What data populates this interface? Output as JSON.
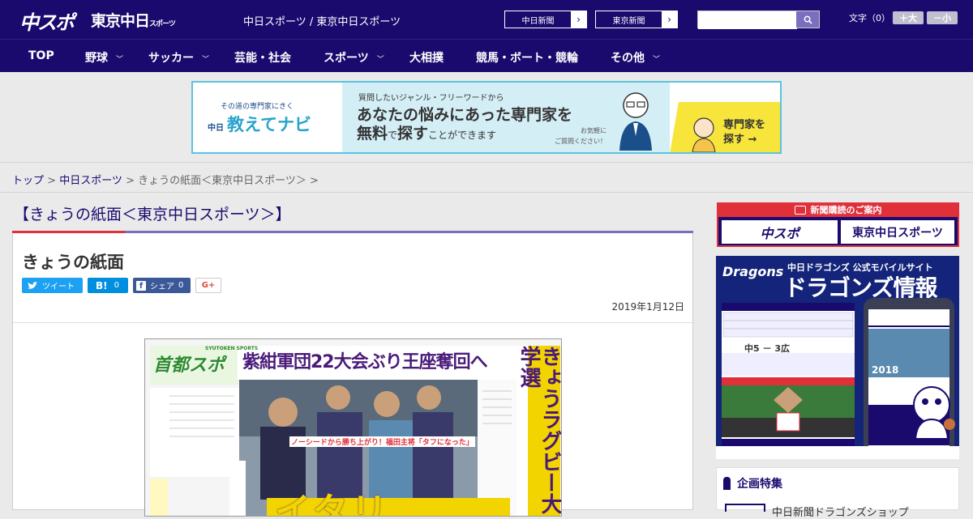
{
  "header": {
    "logo_1": "中スポ",
    "logo_2": "東京中日",
    "logo_2_small": "スポーツ",
    "tagline": "中日スポーツ / 東京中日スポーツ",
    "paper_links": [
      {
        "label": "中日新聞",
        "arrow": "›"
      },
      {
        "label": "東京新聞",
        "arrow": "›"
      }
    ],
    "search_placeholder": "",
    "font_size_label": "文字（0）",
    "font_larger": "＋大",
    "font_smaller": "－小"
  },
  "nav": {
    "items": [
      {
        "label": "TOP",
        "chevron": ""
      },
      {
        "label": "野球",
        "chevron": "﹀"
      },
      {
        "label": "サッカー",
        "chevron": "﹀"
      },
      {
        "label": "芸能・社会",
        "chevron": ""
      },
      {
        "label": "スポーツ",
        "chevron": "﹀"
      },
      {
        "label": "大相撲",
        "chevron": ""
      },
      {
        "label": "競馬・ボート・競輪",
        "chevron": ""
      },
      {
        "label": "その他",
        "chevron": "﹀"
      }
    ]
  },
  "banner": {
    "sub": "その道の専門家にきく",
    "brand_small": "中日",
    "brand": "教えてナビ",
    "line1": "質問したいジャンル・フリーワードから",
    "line2": "あなたの悩みにあった専門家を",
    "line3_a": "無料",
    "line3_b": "で",
    "line3_c": "探す",
    "line3_d": "ことができます",
    "note_1": "お気軽に",
    "note_2": "ご質問ください！",
    "cta_1": "専門家を",
    "cta_2": "探す →"
  },
  "breadcrumb": {
    "home": "トップ",
    "sep": " > ",
    "section": "中日スポーツ",
    "current": "きょうの紙面＜東京中日スポーツ＞",
    "tail": " >"
  },
  "page": {
    "section_title": "【きょうの紙面＜東京中日スポーツ＞】",
    "article_title": "きょうの紙面",
    "date": "2019年1月12日",
    "share": {
      "tweet": "ツイート",
      "hatena": "B!",
      "hatena_count": "0",
      "facebook": "シェア",
      "facebook_count": "0",
      "gplus": "G+"
    }
  },
  "newspaper": {
    "masthead": "首都スポ",
    "masthead_sub": "SYUTOKEN SPORTS",
    "headline": "紫紺軍団22大会ぶり王座奪回へ",
    "side_headline": "きょうラグビー大学選",
    "subline": "ノーシードから勝ち上がり！福田主将「タフになった」",
    "big_text": "イタリ"
  },
  "sidebar": {
    "subscribe_head": "新聞購読のご案内",
    "subscribe_1": "中スポ",
    "subscribe_2": "東京中日スポーツ",
    "dragons_logo": "Dragons",
    "dragons_line1": "中日ドラゴンズ 公式モバイルサイト",
    "dragons_line2": "ドラゴンズ情報",
    "dragons_score": "中5 － 3広",
    "dragons_year": "2018",
    "kikaku_head": "企画特集",
    "kikaku_item": "中日新聞ドラゴンズショップ"
  },
  "colors": {
    "header_bg": "#1a0a6e",
    "accent_red": "#e0303a",
    "accent_purple": "#7a6fbf",
    "banner_border": "#5bc3e0",
    "twitter": "#1da1f2",
    "hatena": "#008fde",
    "facebook": "#3b5998"
  }
}
